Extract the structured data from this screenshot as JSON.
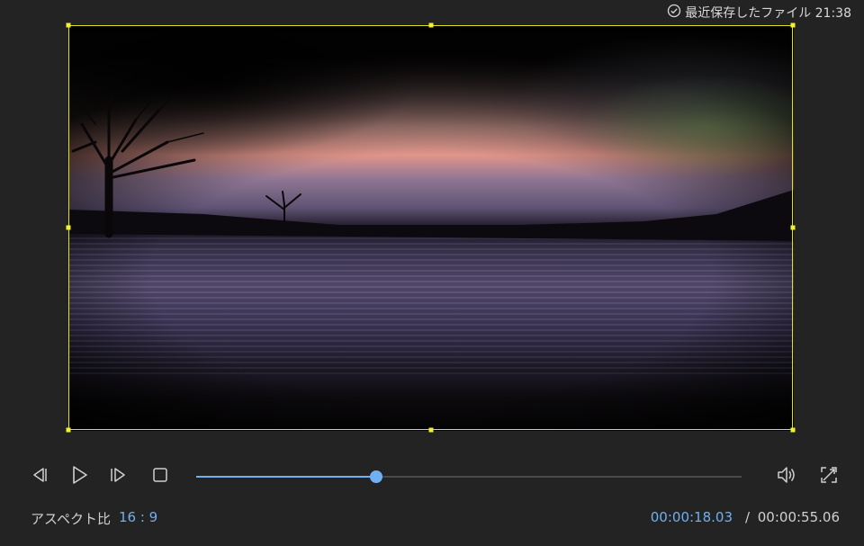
{
  "header": {
    "save_status": "最近保存したファイル 21:38",
    "save_icon": "check-circle-icon"
  },
  "preview": {
    "selection_color": "#e0e024"
  },
  "playback": {
    "prev_icon": "previous-frame-icon",
    "play_icon": "play-icon",
    "next_icon": "next-frame-icon",
    "stop_icon": "stop-icon",
    "volume_icon": "volume-icon",
    "fullscreen_icon": "fullscreen-icon",
    "progress_fraction": 0.33,
    "accent_color": "#6fb0f2"
  },
  "footer": {
    "aspect_label": "アスペクト比",
    "aspect_value": "16 : 9",
    "current_time": "00:00:18.03",
    "separator": "/",
    "total_time": "00:00:55.06"
  }
}
